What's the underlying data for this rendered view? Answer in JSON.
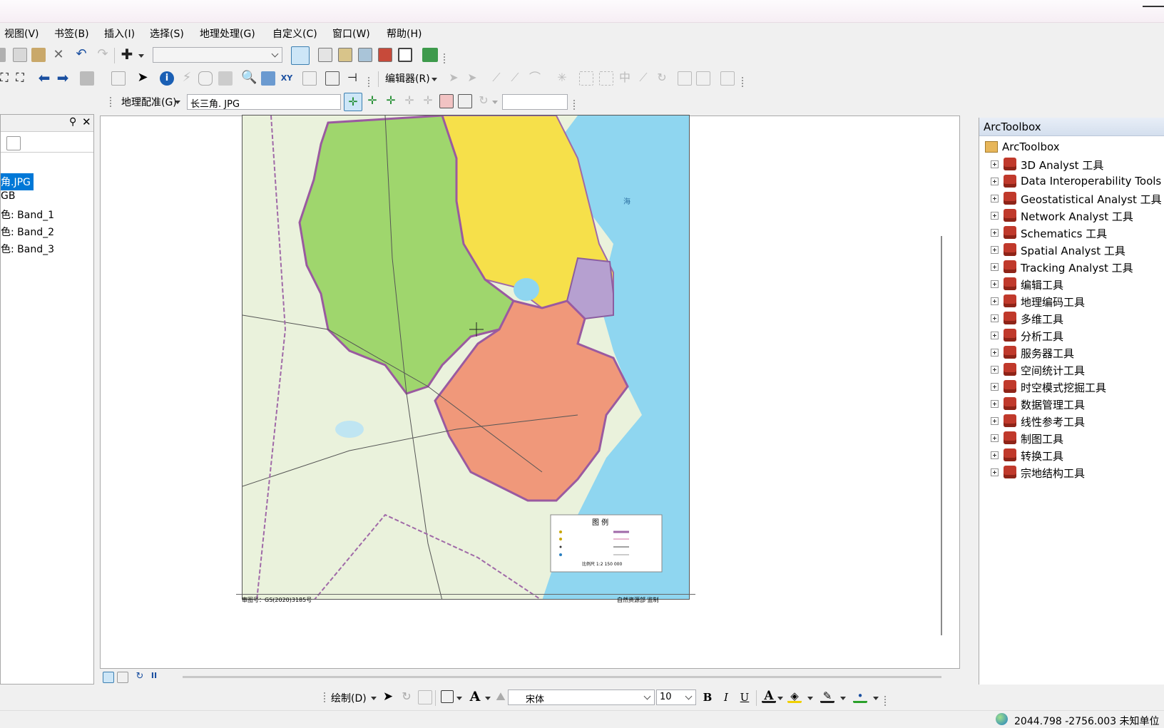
{
  "menus": [
    "视图(V)",
    "书签(B)",
    "插入(I)",
    "选择(S)",
    "地理处理(G)",
    "自定义(C)",
    "窗口(W)",
    "帮助(H)"
  ],
  "editor_toolbar": {
    "label": "编辑器(R)"
  },
  "georef_toolbar": {
    "label": "地理配准(G)",
    "layer_combo": "长三角. JPG"
  },
  "toc": {
    "items": [
      "角.JPG",
      "GB",
      "色:  Band_1",
      "色: Band_2",
      "色:  Band_3"
    ],
    "selected_index": 0
  },
  "toolbox": {
    "title": "ArcToolbox",
    "root": "ArcToolbox",
    "tools": [
      "3D Analyst 工具",
      "Data Interoperability Tools",
      "Geostatistical Analyst 工具",
      "Network Analyst 工具",
      "Schematics 工具",
      "Spatial Analyst 工具",
      "Tracking Analyst 工具",
      "编辑工具",
      "地理编码工具",
      "多维工具",
      "分析工具",
      "服务器工具",
      "空间统计工具",
      "时空模式挖掘工具",
      "数据管理工具",
      "线性参考工具",
      "制图工具",
      "转换工具",
      "宗地结构工具"
    ]
  },
  "map": {
    "legend_title": "图  例",
    "scale_text": "比例尺 1:2 150 000",
    "footer_left": "审图号：GS(2020)3185号",
    "footer_right": "自然资源部 监制",
    "sea_label": "海"
  },
  "drawing_toolbar": {
    "label": "绘制(D)",
    "font": "宋体",
    "font_size": "10"
  },
  "status": {
    "coords": "2044.798  -2756.003 未知单位"
  },
  "colors": {
    "anhui": "#9fd66d",
    "jiangsu": "#f6e04a",
    "zhejiang": "#f0987a",
    "shanghai": "#b6a0d0",
    "sea": "#8fd6f0",
    "land": "#eaf2dc",
    "selection": "#0078d7"
  }
}
